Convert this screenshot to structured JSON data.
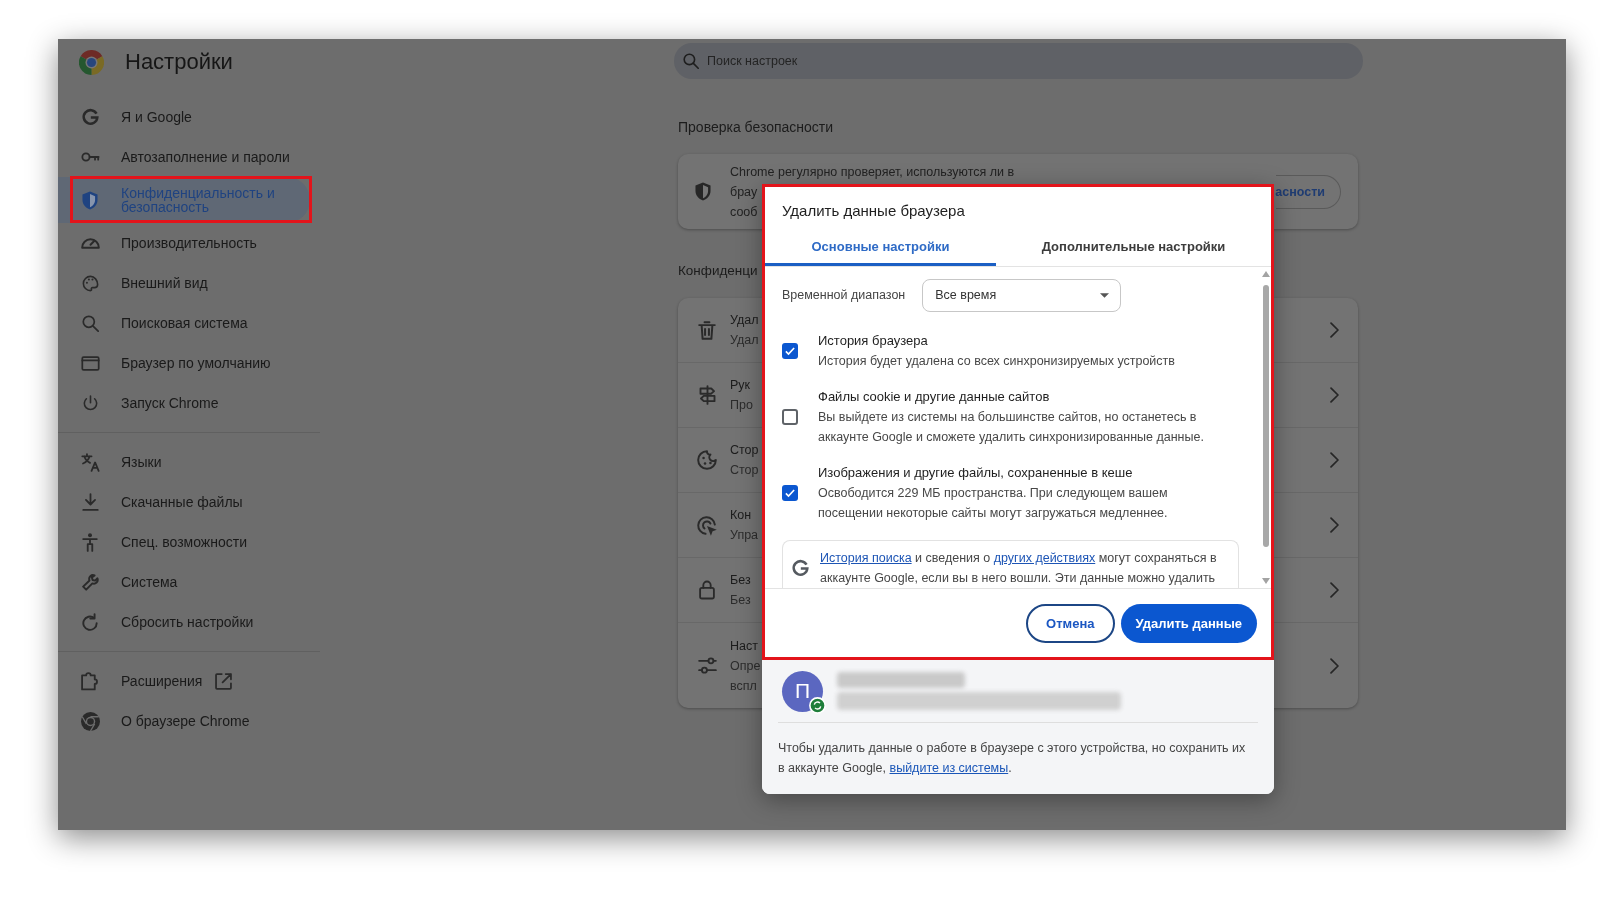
{
  "sidebar": {
    "title": "Настройки",
    "sections": [
      {
        "items": [
          {
            "label": "Я и Google",
            "selected": false,
            "highlighted": false,
            "external": false
          },
          {
            "label": "Автозаполнение и пароли",
            "selected": false,
            "highlighted": false,
            "external": false
          },
          {
            "label": "Конфиденциальность и безопасность",
            "selected": true,
            "highlighted": true,
            "external": false
          },
          {
            "label": "Производительность",
            "selected": false,
            "highlighted": false,
            "external": false
          },
          {
            "label": "Внешний вид",
            "selected": false,
            "highlighted": false,
            "external": false
          },
          {
            "label": "Поисковая система",
            "selected": false,
            "highlighted": false,
            "external": false
          },
          {
            "label": "Браузер по умолчанию",
            "selected": false,
            "highlighted": false,
            "external": false
          },
          {
            "label": "Запуск Chrome",
            "selected": false,
            "highlighted": false,
            "external": false
          }
        ]
      },
      {
        "items": [
          {
            "label": "Языки",
            "selected": false,
            "highlighted": false,
            "external": false
          },
          {
            "label": "Скачанные файлы",
            "selected": false,
            "highlighted": false,
            "external": false
          },
          {
            "label": "Спец. возможности",
            "selected": false,
            "highlighted": false,
            "external": false
          },
          {
            "label": "Система",
            "selected": false,
            "highlighted": false,
            "external": false
          },
          {
            "label": "Сбросить настройки",
            "selected": false,
            "highlighted": false,
            "external": false
          }
        ]
      },
      {
        "items": [
          {
            "label": "Расширения",
            "selected": false,
            "highlighted": false,
            "external": true
          },
          {
            "label": "О браузере Chrome",
            "selected": false,
            "highlighted": false,
            "external": false
          }
        ]
      }
    ]
  },
  "search": {
    "placeholder": "Поиск настроек"
  },
  "safety_check": {
    "heading": "Проверка безопасности",
    "lines": [
      "Chrome регулярно проверяет, используются ли в",
      "брау",
      "сооб"
    ],
    "button": "асности"
  },
  "privacy": {
    "heading": "Конфиденци",
    "rows": [
      {
        "lines": [
          "Удал",
          "Удал"
        ]
      },
      {
        "lines": [
          "Рук",
          "Про"
        ]
      },
      {
        "lines": [
          "Стор",
          "Стор"
        ]
      },
      {
        "lines": [
          "Кон",
          "Упра"
        ]
      },
      {
        "lines": [
          "Без",
          "Без"
        ]
      },
      {
        "lines": [
          "Наст",
          "Опре",
          "вспл"
        ]
      }
    ]
  },
  "dialog": {
    "highlighted": true,
    "title": "Удалить данные браузера",
    "tabs": [
      {
        "label": "Основные настройки",
        "selected": true
      },
      {
        "label": "Дополнительные настройки",
        "selected": false
      }
    ],
    "time_range": {
      "label": "Временной диапазон",
      "value": "Все время"
    },
    "options": [
      {
        "title": "История браузера",
        "description": "История будет удалена со всех синхронизируемых устройств",
        "checked": true
      },
      {
        "title": "Файлы cookie и другие данные сайтов",
        "description": "Вы выйдете из системы на большинстве сайтов, но останетесь в аккаунте Google и сможете удалить синхронизированные данные.",
        "checked": false
      },
      {
        "title": "Изображения и другие файлы, сохраненные в кеше",
        "description": "Освободится 229 МБ пространства. При следующем вашем посещении некоторые сайты могут загружаться медленнее.",
        "checked": true
      }
    ],
    "note": {
      "parts": [
        {
          "kind": "link",
          "text": "История поиска"
        },
        {
          "kind": "text",
          "text": " и сведения о "
        },
        {
          "kind": "link",
          "text": "других действиях"
        },
        {
          "kind": "text",
          "text": " могут сохраняться в аккаунте Google, если вы в него вошли. Эти данные можно удалить"
        }
      ]
    },
    "buttons": [
      {
        "label": "Отмена",
        "kind": "secondary"
      },
      {
        "label": "Удалить данные",
        "kind": "primary"
      }
    ],
    "account": {
      "initial": "П"
    },
    "sign_out_note": {
      "parts": [
        {
          "kind": "text",
          "text": "Чтобы удалить данные о работе в браузере с этого устройства, но сохранить их в аккаунте Google, "
        },
        {
          "kind": "link",
          "text": "выйдите из системы"
        },
        {
          "kind": "text",
          "text": "."
        }
      ]
    }
  }
}
